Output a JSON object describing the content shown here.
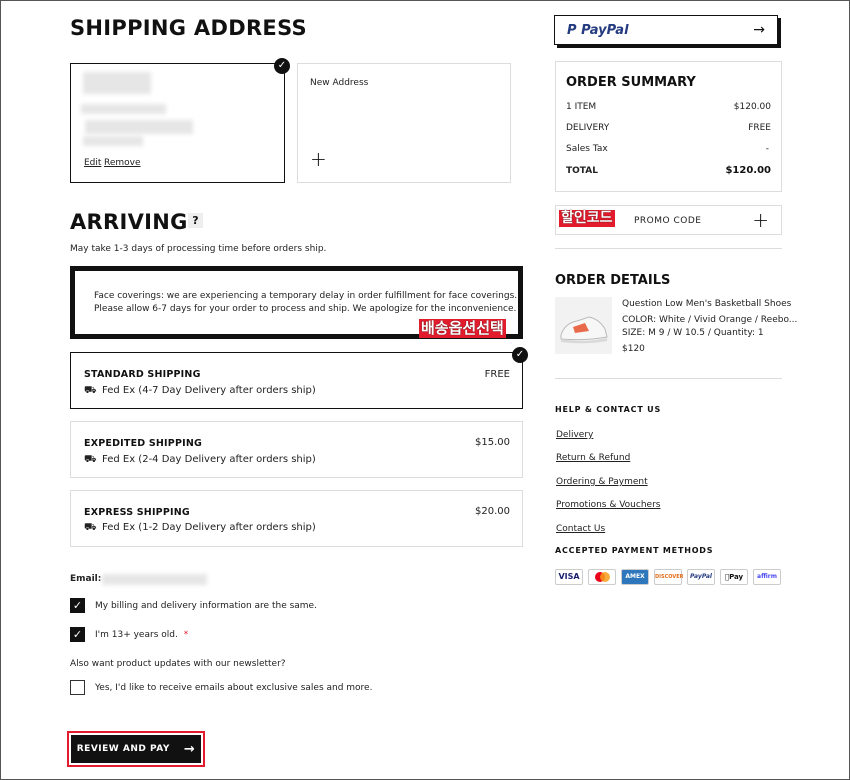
{
  "shipping": {
    "title": "SHIPPING ADDRESS",
    "edit": "Edit",
    "remove": "Remove",
    "new_address": "New Address",
    "plus": "+"
  },
  "arriving": {
    "title": "ARRIVING",
    "help": "?",
    "processing_note": "May take 1-3 days of processing time before orders ship.",
    "notice_line1": "Face coverings: we are experiencing a temporary delay in order fulfillment for face coverings.",
    "notice_line2": "Please allow 6-7 days for your order to process and ship. We apologize for the inconvenience.",
    "annotation": "배송옵션선택"
  },
  "shipping_options": [
    {
      "title": "STANDARD SHIPPING",
      "price": "FREE",
      "carrier": "Fed Ex (4-7 Day Delivery after orders ship)",
      "selected": true
    },
    {
      "title": "EXPEDITED SHIPPING",
      "price": "$15.00",
      "carrier": "Fed Ex (2-4 Day Delivery after orders ship)",
      "selected": false
    },
    {
      "title": "EXPRESS SHIPPING",
      "price": "$20.00",
      "carrier": "Fed Ex (1-2 Day Delivery after orders ship)",
      "selected": false
    }
  ],
  "contact": {
    "email_label": "Email:",
    "billing_same": "My billing and delivery information are the same.",
    "age": "I'm 13+ years old.",
    "required_mark": "*",
    "newsletter_q": "Also want product updates with our newsletter?",
    "newsletter_opt": "Yes, I'd like to receive emails about exclusive sales and more."
  },
  "review_button": {
    "label": "REVIEW AND PAY",
    "arrow": "→"
  },
  "paypal": {
    "label": "PayPal",
    "p_mark": "P",
    "arrow": "→"
  },
  "summary": {
    "title": "ORDER SUMMARY",
    "rows": [
      {
        "label": "1 ITEM",
        "value": "$120.00"
      },
      {
        "label": "DELIVERY",
        "value": "FREE"
      },
      {
        "label": "Sales Tax",
        "value": "-"
      }
    ],
    "total_label": "TOTAL",
    "total_value": "$120.00"
  },
  "promo": {
    "annotation": "할인코드",
    "label": "PROMO CODE",
    "plus": "+"
  },
  "order_details": {
    "title": "ORDER DETAILS",
    "product_name": "Question Low Men's Basketball Shoes",
    "color": "COLOR: White / Vivid Orange / Reebo...",
    "size": "SIZE: M 9 / W 10.5 / Quantity: 1",
    "price": "$120"
  },
  "help": {
    "title": "HELP & CONTACT US",
    "links": [
      "Delivery",
      "Return & Refund",
      "Ordering & Payment",
      "Promotions & Vouchers",
      "Contact Us"
    ]
  },
  "payment": {
    "title": "ACCEPTED PAYMENT METHODS",
    "methods": [
      "VISA",
      "MC",
      "AMEX",
      "DISCOVER",
      "PayPal",
      "Pay",
      "affirm"
    ]
  },
  "colors": {
    "accent_red": "#e31c2d",
    "black": "#111111",
    "paypal_blue": "#253b80",
    "paypal_light": "#179bd7"
  }
}
